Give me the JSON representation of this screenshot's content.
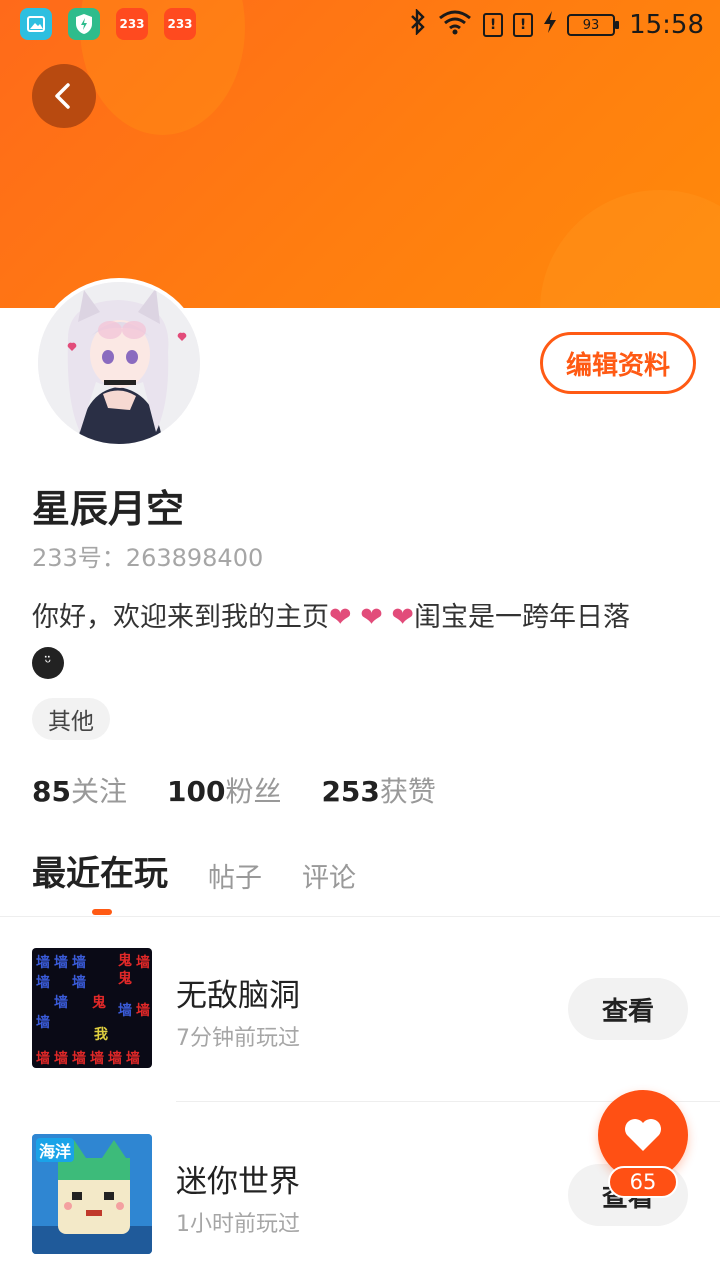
{
  "status_bar": {
    "notification_icons": [
      "gallery-icon",
      "shield-icon",
      "233-app-icon",
      "233-app-icon"
    ],
    "app_badge_233": "233",
    "sim1": "!",
    "sim2": "!",
    "battery": "93",
    "time": "15:58"
  },
  "profile": {
    "name": "星辰月空",
    "uid": "233号：263898400",
    "bio_text_1": "你好，欢迎来到我的主页",
    "bio_hearts": "❤ ❤ ❤",
    "bio_text_2": "闺宝是一跨年日落",
    "tag": "其他",
    "edit_label": "编辑资料"
  },
  "stats": [
    {
      "num": "85",
      "label": "关注"
    },
    {
      "num": "100",
      "label": "粉丝"
    },
    {
      "num": "253",
      "label": "获赞"
    }
  ],
  "tabs": [
    "最近在玩",
    "帖子",
    "评论"
  ],
  "games": [
    {
      "name": "无敌脑洞",
      "time": "7分钟前玩过",
      "action": "查看"
    },
    {
      "name": "迷你世界",
      "time": "1小时前玩过",
      "action": "查看"
    }
  ],
  "thumb1_chars": {
    "wall": "墙",
    "ghost": "鬼",
    "me": "我"
  },
  "thumb2_badge": "海洋",
  "like_count": "65",
  "colors": {
    "accent": "#ff5a14",
    "header": "#ff7d10"
  }
}
